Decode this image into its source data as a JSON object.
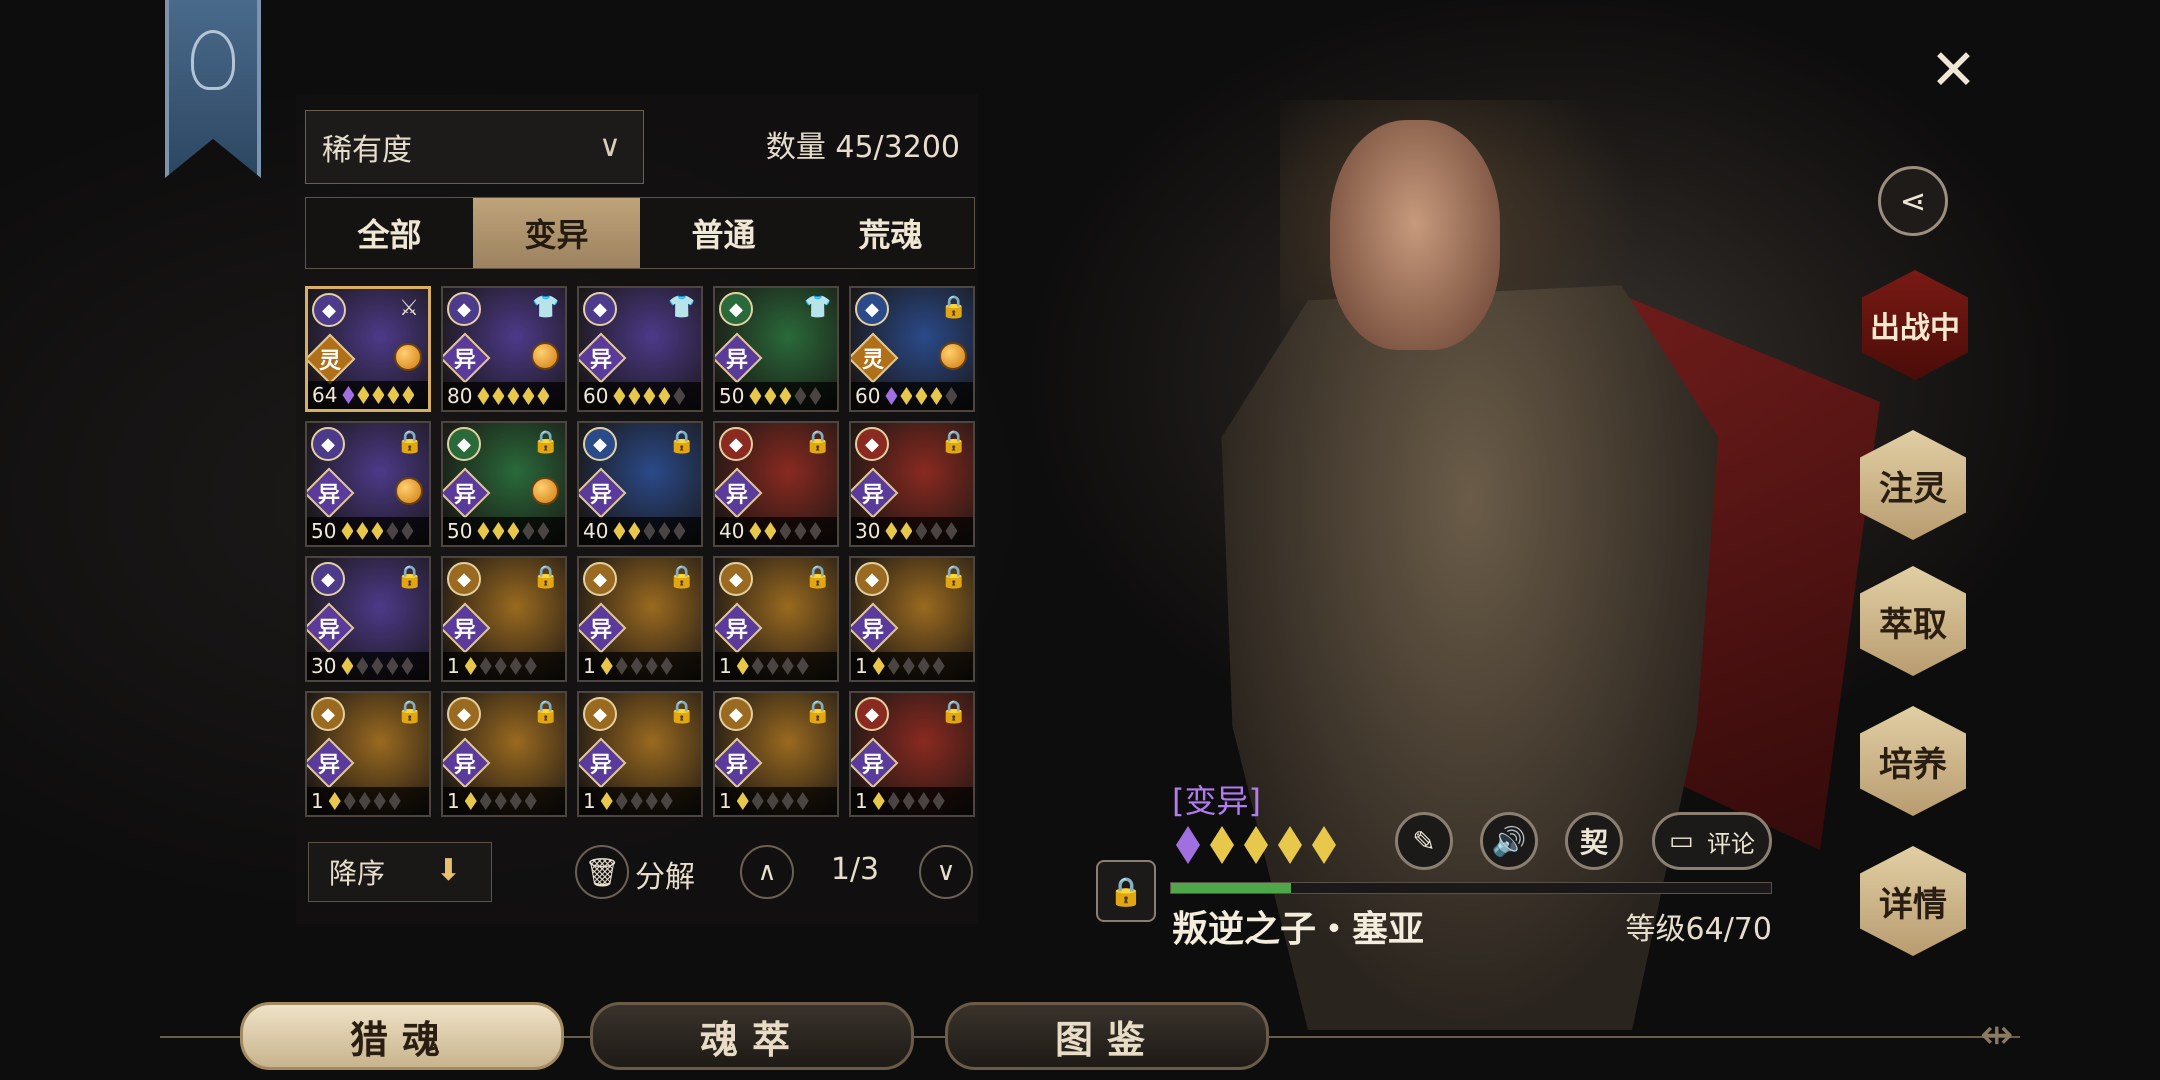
{
  "panel": {
    "sort_label": "稀有度",
    "count_label": "数量 45/3200",
    "tabs": [
      {
        "label": "全部"
      },
      {
        "label": "变异"
      },
      {
        "label": "普通"
      },
      {
        "label": "荒魂"
      }
    ],
    "active_tab": 1,
    "cards": [
      {
        "level": "64",
        "type": "灵",
        "rarity": "purple",
        "stars": [
          "p",
          "g",
          "g",
          "g",
          "g"
        ],
        "badge": "swords-icon",
        "orb": true,
        "selected": true
      },
      {
        "level": "80",
        "type": "异",
        "rarity": "purple",
        "stars": [
          "g",
          "g",
          "g",
          "g",
          "g"
        ],
        "badge": "shirt-icon",
        "orb": true
      },
      {
        "level": "60",
        "type": "异",
        "rarity": "purple",
        "stars": [
          "g",
          "g",
          "g",
          "g",
          "e"
        ],
        "badge": "shirt-icon"
      },
      {
        "level": "50",
        "type": "异",
        "rarity": "green",
        "stars": [
          "g",
          "g",
          "g",
          "e",
          "e"
        ],
        "badge": "shirt-icon"
      },
      {
        "level": "60",
        "type": "灵",
        "rarity": "blue",
        "stars": [
          "p",
          "g",
          "g",
          "g",
          "e"
        ],
        "badge": "lock-icon",
        "orb": true
      },
      {
        "level": "50",
        "type": "异",
        "rarity": "purple",
        "stars": [
          "g",
          "g",
          "g",
          "e",
          "e"
        ],
        "badge": "lock-icon",
        "orb": true
      },
      {
        "level": "50",
        "type": "异",
        "rarity": "green",
        "stars": [
          "g",
          "g",
          "g",
          "e",
          "e"
        ],
        "badge": "lock-icon",
        "orb": true
      },
      {
        "level": "40",
        "type": "异",
        "rarity": "blue",
        "stars": [
          "g",
          "g",
          "e",
          "e",
          "e"
        ],
        "badge": "lock-icon"
      },
      {
        "level": "40",
        "type": "异",
        "rarity": "red",
        "stars": [
          "g",
          "g",
          "e",
          "e",
          "e"
        ],
        "badge": "lock-icon"
      },
      {
        "level": "30",
        "type": "异",
        "rarity": "red",
        "stars": [
          "g",
          "g",
          "e",
          "e",
          "e"
        ],
        "badge": "lock-icon"
      },
      {
        "level": "30",
        "type": "异",
        "rarity": "purple",
        "stars": [
          "g",
          "e",
          "e",
          "e",
          "e"
        ],
        "badge": "lock-icon"
      },
      {
        "level": "1",
        "type": "异",
        "rarity": "gold",
        "stars": [
          "g",
          "e",
          "e",
          "e",
          "e"
        ],
        "badge": "lock-icon"
      },
      {
        "level": "1",
        "type": "异",
        "rarity": "gold",
        "stars": [
          "g",
          "e",
          "e",
          "e",
          "e"
        ],
        "badge": "lock-icon"
      },
      {
        "level": "1",
        "type": "异",
        "rarity": "gold",
        "stars": [
          "g",
          "e",
          "e",
          "e",
          "e"
        ],
        "badge": "lock-icon"
      },
      {
        "level": "1",
        "type": "异",
        "rarity": "gold",
        "stars": [
          "g",
          "e",
          "e",
          "e",
          "e"
        ],
        "badge": "lock-icon"
      },
      {
        "level": "1",
        "type": "异",
        "rarity": "gold",
        "stars": [
          "g",
          "e",
          "e",
          "e",
          "e"
        ],
        "badge": "lock-icon"
      },
      {
        "level": "1",
        "type": "异",
        "rarity": "gold",
        "stars": [
          "g",
          "e",
          "e",
          "e",
          "e"
        ],
        "badge": "lock-icon"
      },
      {
        "level": "1",
        "type": "异",
        "rarity": "gold",
        "stars": [
          "g",
          "e",
          "e",
          "e",
          "e"
        ],
        "badge": "lock-icon"
      },
      {
        "level": "1",
        "type": "异",
        "rarity": "gold",
        "stars": [
          "g",
          "e",
          "e",
          "e",
          "e"
        ],
        "badge": "lock-icon"
      },
      {
        "level": "1",
        "type": "异",
        "rarity": "red",
        "stars": [
          "g",
          "e",
          "e",
          "e",
          "e"
        ],
        "badge": "lock-icon"
      }
    ],
    "order_label": "降序",
    "decompose_label": "分解",
    "page_indicator": "1/3"
  },
  "hero": {
    "type_label": "[变异]",
    "stars": [
      "p",
      "g",
      "g",
      "g",
      "g"
    ],
    "name": "叛逆之子・塞亚",
    "level_label": "等级64/70",
    "xp_fraction": 0.2,
    "actions": {
      "contract_label": "契",
      "comment_label": "评论"
    }
  },
  "side_menu": {
    "deployed_label": "出战中",
    "infuse_label": "注灵",
    "extract_label": "萃取",
    "cultivate_label": "培养",
    "details_label": "详情"
  },
  "bottom_nav": [
    {
      "label": "猎魂"
    },
    {
      "label": "魂萃"
    },
    {
      "label": "图鉴"
    }
  ],
  "active_nav": 0,
  "colors": {
    "accent_gold": "#c8b48e",
    "type_purple": "#b07cf0",
    "xp_green": "#4ea84a",
    "rarity": {
      "purple": "#4c3a8a",
      "green": "#2a6a3a",
      "blue": "#2a4a8a",
      "red": "#8a2a20",
      "gold": "#9a6a20"
    }
  }
}
